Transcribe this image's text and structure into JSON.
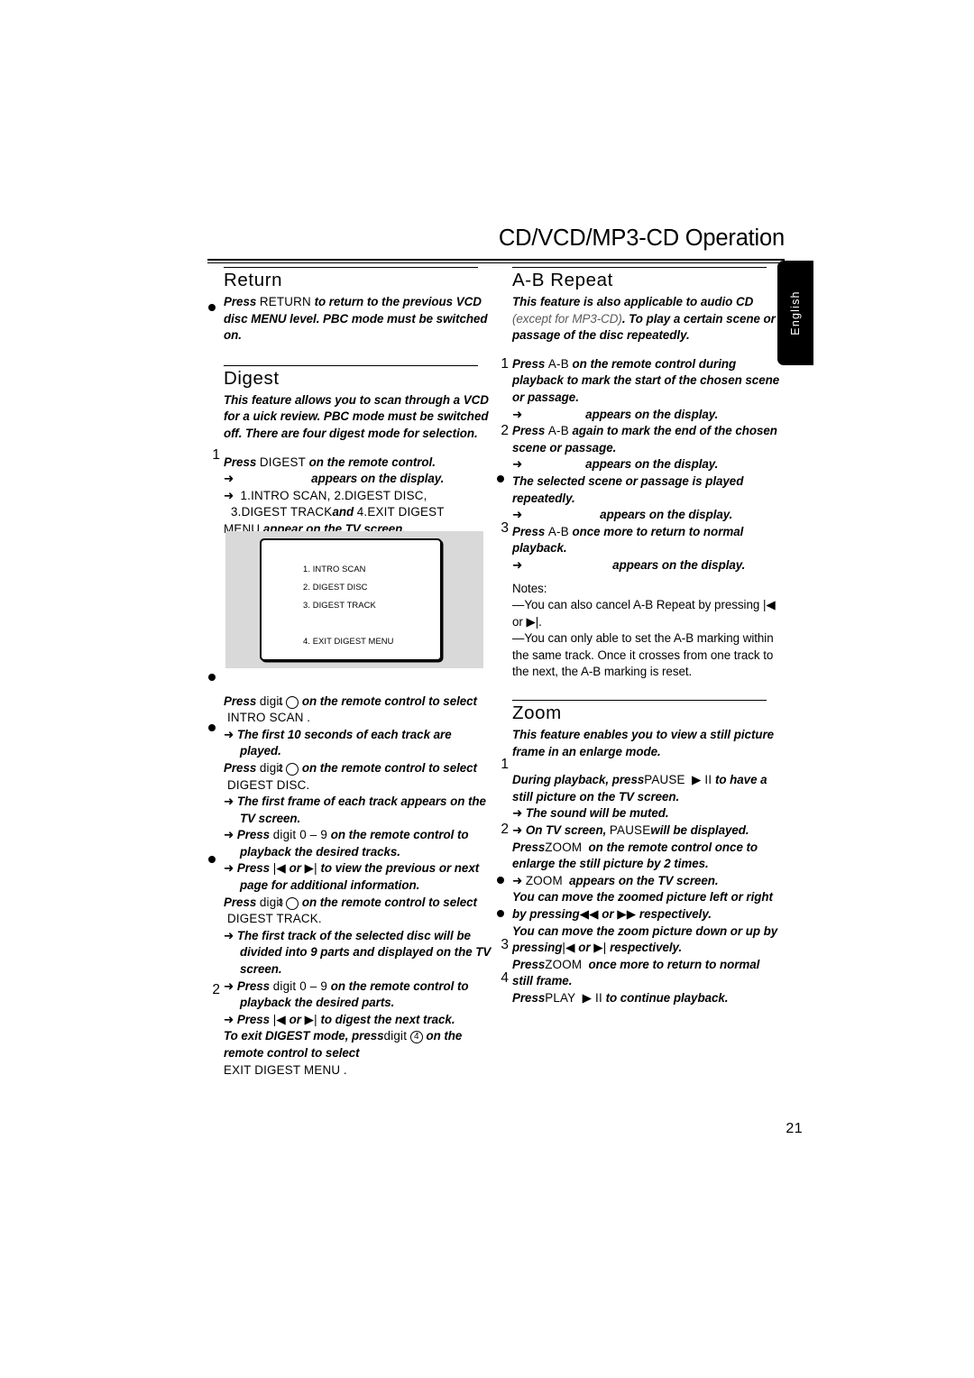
{
  "header": {
    "title": "CD/VCD/MP3-CD Operation",
    "language_tab": "English",
    "page_number": "21"
  },
  "sections": {
    "return": {
      "heading": "Return",
      "bullet1_a": "Press",
      "bullet1_key": "RETURN",
      "bullet1_b": "to return to the previous VCD disc MENU level.  PBC mode must be switched on."
    },
    "digest": {
      "heading": "Digest",
      "intro": "This feature allows you to scan through a VCD for a  uick review. PBC mode must be switched off. There are four digest mode for selection.",
      "step1_a": "Press",
      "step1_key": "DIGEST",
      "step1_b": "on the remote control.",
      "step1_arrow1": "appears on the display.",
      "step1_arrow2_a": "1.INTRO SCAN",
      "step1_arrow2_b": ", 2.DIGEST DISC,",
      "step1_arrow2_c": "3.DIGEST TRACK",
      "step1_arrow2_and": "and",
      "step1_arrow2_d": "4.EXIT DIGEST",
      "step1_arrow2_e": "MENU",
      "step1_arrow2_f": "appear on the TV screen.",
      "tv_menu": {
        "item1": "1.  INTRO SCAN",
        "item2": "2.  DIGEST DISC",
        "item3": "3.  DIGEST TRACK",
        "item4": "4.  EXIT DIGEST MENU"
      },
      "b1_press": "Press",
      "b1_digit": "digit",
      "b1_num": "1",
      "b1_tail": "on the remote control to select",
      "b1_target": "INTRO SCAN",
      "b1_period": ".",
      "b1_arrow": "The first 10 seconds of each track are played.",
      "b2_press": "Press",
      "b2_digit": "digit",
      "b2_num": "2",
      "b2_tail": "on the remote control to select",
      "b2_target": "DIGEST DISC",
      "b2_period": ".",
      "b2_arrow1": "The first frame of each track appears on the TV screen.",
      "b2_arrow2_a": "Press",
      "b2_arrow2_digit": "digit 0 – 9",
      "b2_arrow2_b": "on the remote control to playback the desired tracks.",
      "b2_arrow3_a": "Press",
      "b2_arrow3_b": "or",
      "b2_arrow3_c": "to view the previous or next page for additional information.",
      "b3_press": "Press",
      "b3_digit": "digit",
      "b3_num": "3",
      "b3_tail": "on the remote control to select",
      "b3_target": "DIGEST TRACK",
      "b3_period": ".",
      "b3_arrow1": "The first track of the selected disc will be divided into 9 parts and displayed on the TV screen.",
      "b3_arrow2_a": "Press",
      "b3_arrow2_digit": "digit 0 – 9",
      "b3_arrow2_b": "on the remote control to playback the desired parts.",
      "b3_arrow3_a": "Press",
      "b3_arrow3_b": "or",
      "b3_arrow3_c": "to digest the next track.",
      "step2_a": "To exit DIGEST mode, press",
      "step2_digit": "digit",
      "step2_num": "4",
      "step2_b": "on the remote control to select",
      "step2_target": "EXIT DIGEST MENU",
      "step2_period": "."
    },
    "ab_repeat": {
      "heading": "A-B Repeat",
      "intro_a": "This feature is also applicable to audio CD",
      "intro_grey": "(except for MP3-CD)",
      "intro_b": ". To play a certain scene or passage of the disc repeatedly.",
      "step1_a": "Press",
      "step1_key": "A-B",
      "step1_b": "on the remote control during playback to mark the start of the chosen scene or passage.",
      "step1_arrow": "appears on the display.",
      "step2_a": "Press",
      "step2_key": "A-B",
      "step2_b": "again to mark the end of the chosen scene or passage.",
      "step2_arrow": "appears on the display.",
      "bullet": "The selected scene or passage is played repeatedly.",
      "bullet_arrow": "appears on the display.",
      "step3_a": "Press",
      "step3_key": "A-B",
      "step3_b": "once more to return to normal playback.",
      "step3_arrow": "appears on the display.",
      "notes_label": "Notes:",
      "note1_a": "—You can also cancel A-B Repeat by pressing",
      "note1_b": "or",
      "note1_c": ".",
      "note2": "—You can only able to set the A-B marking within the same track. Once it crosses from one track to the next, the A-B marking is reset."
    },
    "zoom": {
      "heading": "Zoom",
      "intro": "This feature enables you to view a still picture frame in an enlarge mode.",
      "step1_a": "During playback, press",
      "step1_key": "PAUSE",
      "step1_b": "to have a still picture on the TV screen.",
      "step1_arrow1": "The sound will be muted.",
      "step1_arrow2_a": "On TV screen,",
      "step1_arrow2_key": "PAUSE",
      "step1_arrow2_b": "will be displayed.",
      "step2_a": "Press",
      "step2_key": "ZOOM",
      "step2_b": "on the remote control once to enlarge the still picture by 2 times.",
      "step2_arrow_key": "ZOOM",
      "step2_arrow_b": "appears on the TV screen.",
      "bullet1_a": "You can move the zoomed picture left or right by pressing",
      "bullet1_b": "or",
      "bullet1_c": "respectively.",
      "bullet2_a": "You can move the zoom picture down or up by pressing",
      "bullet2_b": "or",
      "bullet2_c": "respectively.",
      "step3_a": "Press",
      "step3_key": "ZOOM",
      "step3_b": "once more to return to normal still frame.",
      "step4_a": "Press",
      "step4_key": "PLAY",
      "step4_b": "to continue playback."
    }
  },
  "icons": {
    "arrow": "➜",
    "prev": "|◀",
    "next": "▶|",
    "rew": "◀◀",
    "ffwd": "▶▶",
    "playpause": "▶ II"
  },
  "markers": {
    "left": [
      "1",
      "2"
    ],
    "right": [
      "1",
      "2",
      "3",
      "1",
      "2",
      "3",
      "4"
    ]
  }
}
